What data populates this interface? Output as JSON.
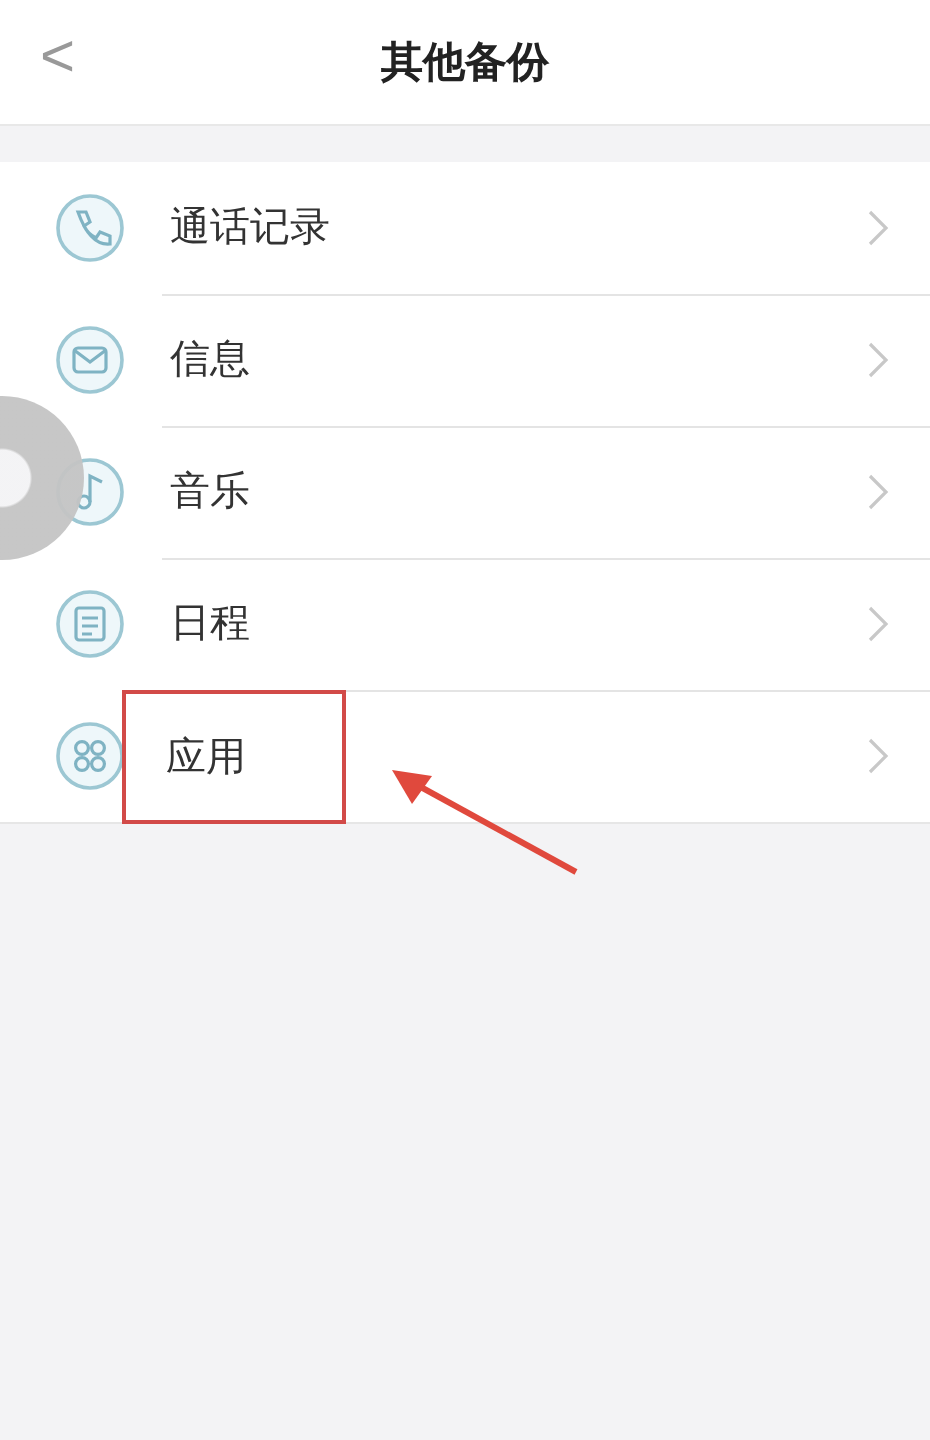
{
  "header": {
    "back": "<",
    "title": "其他备份"
  },
  "items": [
    {
      "label": "通话记录",
      "kind": "phone",
      "highlighted": false
    },
    {
      "label": "信息",
      "kind": "mail",
      "highlighted": false
    },
    {
      "label": "音乐",
      "kind": "music",
      "highlighted": false
    },
    {
      "label": "日程",
      "kind": "calendar",
      "highlighted": false
    },
    {
      "label": "应用",
      "kind": "apps",
      "highlighted": true
    }
  ]
}
